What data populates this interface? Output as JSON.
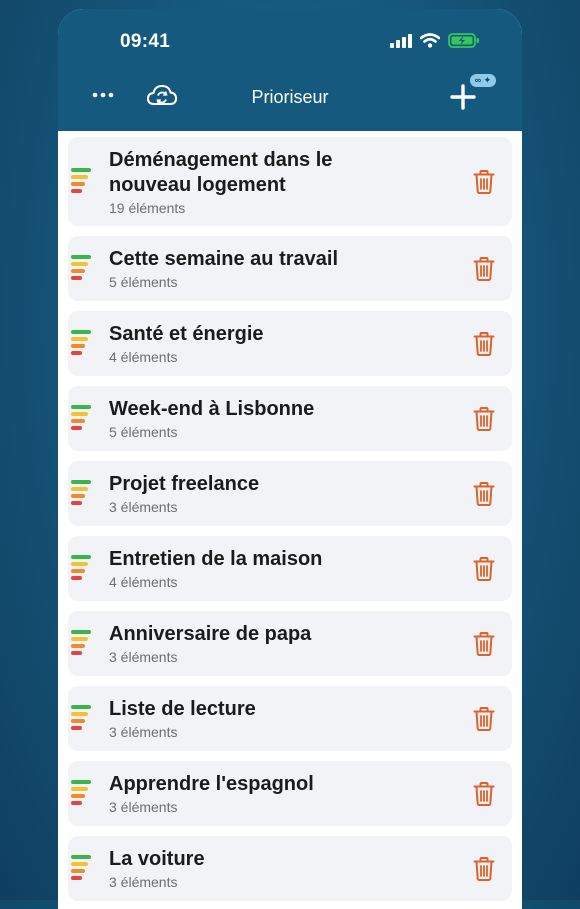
{
  "status": {
    "time": "09:41"
  },
  "nav": {
    "title": "Prioriseur",
    "badge": "∞ ✦"
  },
  "lists": [
    {
      "title": "Déménagement dans le nouveau logement",
      "count": "19 éléments"
    },
    {
      "title": "Cette semaine au travail",
      "count": "5 éléments"
    },
    {
      "title": "Santé et énergie",
      "count": "4 éléments"
    },
    {
      "title": "Week-end à Lisbonne",
      "count": "5 éléments"
    },
    {
      "title": "Projet freelance",
      "count": "3 éléments"
    },
    {
      "title": "Entretien de la maison",
      "count": "4 éléments"
    },
    {
      "title": "Anniversaire de papa",
      "count": "3 éléments"
    },
    {
      "title": "Liste de lecture",
      "count": "3 éléments"
    },
    {
      "title": "Apprendre l'espagnol",
      "count": "3 éléments"
    },
    {
      "title": "La voiture",
      "count": "3 éléments"
    }
  ],
  "colors": {
    "header": "#155a7e",
    "card": "#f1f3f7",
    "trash": "#e0612a",
    "priority": [
      "#3bb54a",
      "#f2c232",
      "#ef8a2d",
      "#e5443e"
    ]
  },
  "icons": {
    "more": "more-icon",
    "sync": "cloud-sync-icon",
    "add": "plus-icon",
    "delete": "trash-icon",
    "priority": "priority-bars-icon"
  }
}
